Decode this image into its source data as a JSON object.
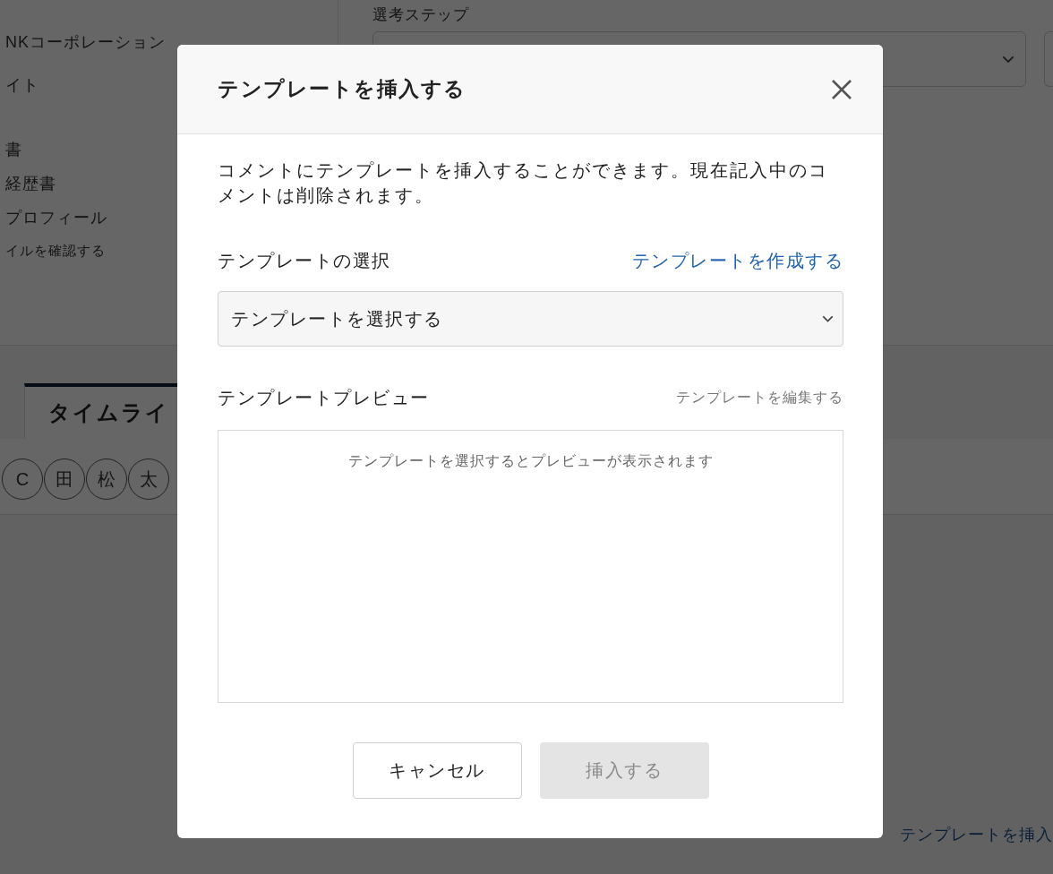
{
  "background": {
    "company": "NKコーポレーション",
    "item_2": "イト",
    "documents": [
      "書",
      "経歴書",
      "プロフィール",
      "イルを確認する"
    ],
    "step_label": "選考ステップ",
    "tabs": [
      {
        "label": "タイムライ",
        "selected": true
      }
    ],
    "members": [
      "C",
      "田",
      "松",
      "太"
    ],
    "insert_link": "テンプレートを挿入"
  },
  "dialog": {
    "title": "テンプレートを挿入する",
    "description": "コメントにテンプレートを挿入することができます。現在記入中のコメントは削除されます。",
    "template_select": {
      "label": "テンプレートの選択",
      "create_link": "テンプレートを作成する",
      "value": "テンプレートを選択する"
    },
    "preview": {
      "label": "テンプレートプレビュー",
      "edit_link": "テンプレートを編集する",
      "empty_text": "テンプレートを選択するとプレビューが表示されます"
    },
    "buttons": [
      {
        "label": "キャンセル",
        "kind": "secondary",
        "disabled": false
      },
      {
        "label": "挿入する",
        "kind": "primary",
        "disabled": true
      }
    ]
  }
}
